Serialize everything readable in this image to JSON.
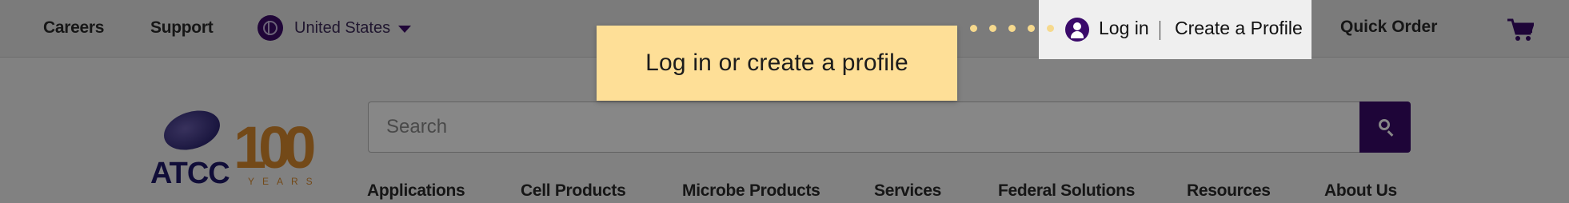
{
  "utility_bar": {
    "careers": "Careers",
    "support": "Support",
    "country": "United States",
    "quick_order": "Quick Order"
  },
  "account": {
    "login": "Log in",
    "create_profile": "Create a Profile"
  },
  "tooltip": {
    "text": "Log in or create a profile"
  },
  "logo": {
    "brand": "ATCC",
    "anniversary": "100",
    "years": "YEARS"
  },
  "search": {
    "placeholder": "Search"
  },
  "nav": {
    "items": [
      "Applications",
      "Cell Products",
      "Microbe Products",
      "Services",
      "Federal Solutions",
      "Resources",
      "About Us"
    ]
  },
  "colors": {
    "brand_purple": "#3a0a6a",
    "tooltip_yellow": "#fedf97",
    "anniversary_orange": "#d98a2e",
    "overlay": "rgba(0,0,0,0.47)"
  },
  "icons": {
    "country": "globe-icon",
    "country_dropdown": "chevron-down-icon",
    "cart": "cart-icon",
    "search": "search-icon",
    "user": "user-icon"
  }
}
